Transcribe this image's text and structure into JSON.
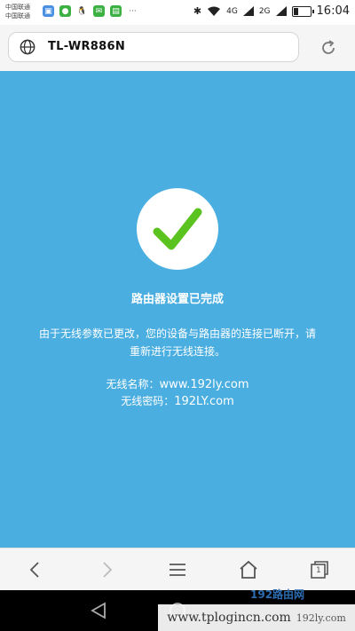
{
  "status_bar": {
    "carrier_line1": "中国联通",
    "carrier_line2": "中国联通",
    "network1": "4G",
    "network2": "2G",
    "time": "16:04",
    "notification_icons": [
      "image-icon",
      "wechat-icon",
      "qq-icon",
      "sms-icon",
      "calendar-icon",
      "more-icon"
    ]
  },
  "browser": {
    "url": "TL-WR886N"
  },
  "page": {
    "done_title": "路由器设置已完成",
    "message": "由于无线参数已更改，您的设备与路由器的连接已断开，请重新进行无线连接。",
    "wifi_name_label": "无线名称：",
    "wifi_name_value": "www.192ly.com",
    "wifi_pw_label": "无线密码：",
    "wifi_pw_value": "192LY.com"
  },
  "nav": {
    "icons": [
      "back-icon",
      "forward-icon",
      "menu-icon",
      "home-icon",
      "tabs-icon"
    ],
    "tab_count": "1"
  },
  "watermark": {
    "text": "www.tplogincn.com",
    "logo_a": "192路由网",
    "logo_b": "192ly.com"
  },
  "colors": {
    "content_bg": "#4aaee0",
    "check_green": "#5ac31f"
  }
}
